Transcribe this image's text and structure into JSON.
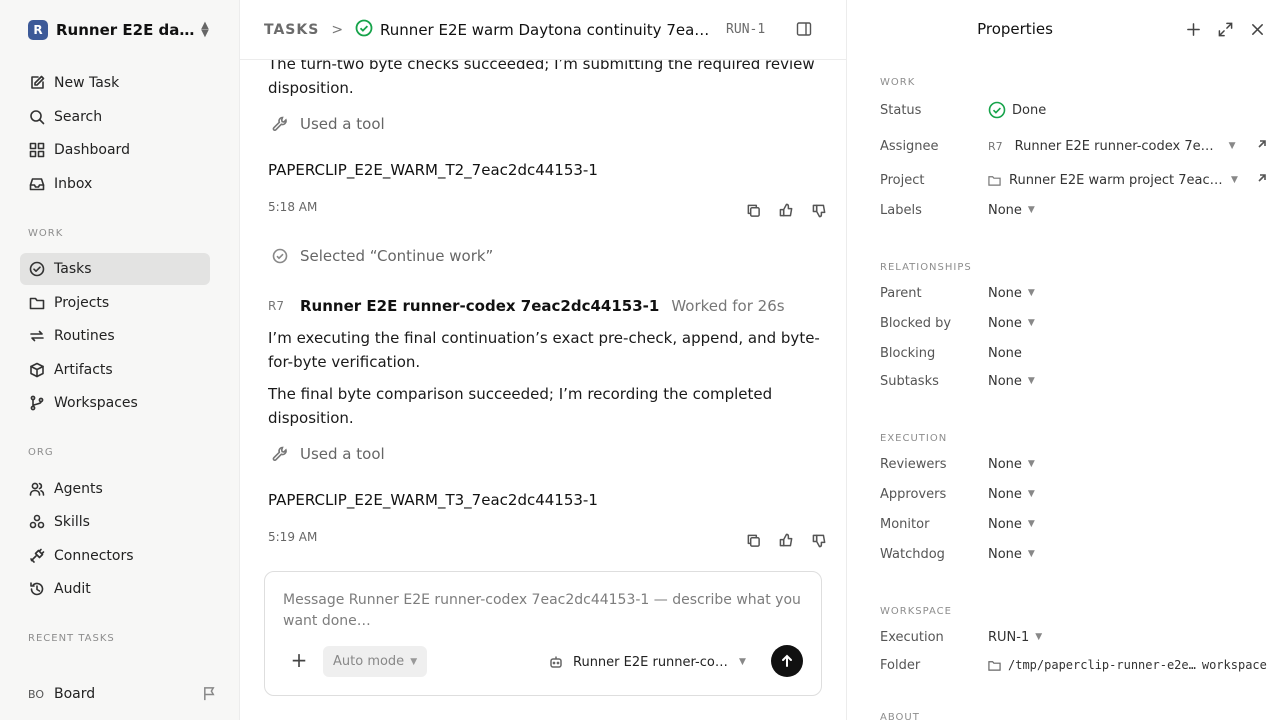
{
  "workspace": {
    "logo_letter": "R",
    "name": "Runner E2E da..."
  },
  "sidebar": {
    "top_items": [
      {
        "label": "New Task",
        "icon": "edit-icon"
      },
      {
        "label": "Search",
        "icon": "search-icon"
      },
      {
        "label": "Dashboard",
        "icon": "grid-icon"
      },
      {
        "label": "Inbox",
        "icon": "inbox-icon"
      }
    ],
    "work_label": "WORK",
    "work_items": [
      {
        "label": "Tasks",
        "icon": "check-circle-icon",
        "active": true
      },
      {
        "label": "Projects",
        "icon": "folder-icon"
      },
      {
        "label": "Routines",
        "icon": "repeat-icon"
      },
      {
        "label": "Artifacts",
        "icon": "box-icon"
      },
      {
        "label": "Workspaces",
        "icon": "branch-icon"
      }
    ],
    "org_label": "ORG",
    "org_items": [
      {
        "label": "Agents",
        "icon": "users-icon"
      },
      {
        "label": "Skills",
        "icon": "skills-icon"
      },
      {
        "label": "Connectors",
        "icon": "plug-icon"
      },
      {
        "label": "Audit",
        "icon": "history-icon"
      }
    ],
    "recent_label": "RECENT TASKS",
    "board": {
      "avatar": "BO",
      "label": "Board"
    }
  },
  "header": {
    "root": "TASKS",
    "separator": ">",
    "title": "Runner E2E warm Daytona continuity 7eac2d...",
    "id": "RUN-1"
  },
  "feed": {
    "msg1_text": "The turn-two byte checks succeeded; I’m submitting the required review disposition.",
    "tool1": "Used a tool",
    "marker1": "PAPERCLIP_E2E_WARM_T2_7eac2dc44153-1",
    "time1": "5:18 AM",
    "selected": "Selected “Continue work”",
    "author_avatar": "R7",
    "author_name": "Runner E2E runner-codex 7eac2dc44153-1",
    "worked": "Worked for 26s",
    "msg2_text": "I’m executing the final continuation’s exact pre-check, append, and byte-for-byte verification.",
    "msg3_text": "The final byte comparison succeeded; I’m recording the completed disposition.",
    "tool2": "Used a tool",
    "marker2": "PAPERCLIP_E2E_WARM_T3_7eac2dc44153-1",
    "time2": "5:19 AM"
  },
  "composer": {
    "placeholder": "Message Runner E2E runner-codex 7eac2dc44153-1 — describe what you want done…",
    "plus": "+",
    "mode": "Auto mode",
    "agent": "Runner E2E runner-code..."
  },
  "properties": {
    "title": "Properties",
    "work_label": "WORK",
    "status_label": "Status",
    "status_value": "Done",
    "assignee_label": "Assignee",
    "assignee_avatar": "R7",
    "assignee_value": "Runner E2E runner-codex 7eac2...",
    "project_label": "Project",
    "project_value": "Runner E2E warm project 7eac2d...",
    "labels_label": "Labels",
    "labels_value": "None",
    "rel_label": "RELATIONSHIPS",
    "parent_label": "Parent",
    "parent_value": "None",
    "blockedby_label": "Blocked by",
    "blockedby_value": "None",
    "blocking_label": "Blocking",
    "blocking_value": "None",
    "subtasks_label": "Subtasks",
    "subtasks_value": "None",
    "exec_label": "EXECUTION",
    "reviewers_label": "Reviewers",
    "reviewers_value": "None",
    "approvers_label": "Approvers",
    "approvers_value": "None",
    "monitor_label": "Monitor",
    "monitor_value": "None",
    "watchdog_label": "Watchdog",
    "watchdog_value": "None",
    "ws_label": "WORKSPACE",
    "execution_label": "Execution",
    "execution_value": "RUN-1",
    "folder_label": "Folder",
    "folder_value": "/tmp/paperclip-runner-e2e…",
    "folder_suffix": "workspace",
    "about_label": "ABOUT"
  },
  "colors": {
    "accent_green": "#16a34a",
    "logo_blue": "#3d5a98",
    "active_bg": "#e3e3e2"
  }
}
